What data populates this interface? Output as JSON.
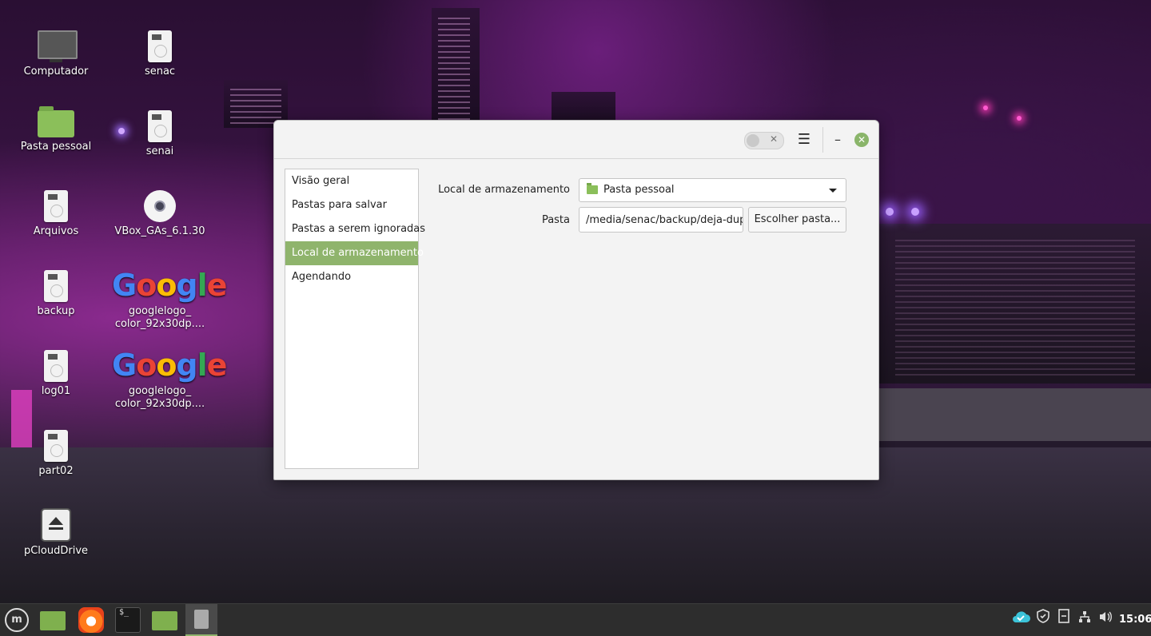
{
  "desktop": {
    "icons": [
      {
        "label": "Computador",
        "icon": "computer-icon"
      },
      {
        "label": "senac",
        "icon": "drive-icon"
      },
      {
        "label": "Pasta pessoal",
        "icon": "home-folder-icon"
      },
      {
        "label": "senai",
        "icon": "drive-icon"
      },
      {
        "label": "Arquivos",
        "icon": "drive-icon"
      },
      {
        "label": "VBox_GAs_6.1.30",
        "icon": "cd-icon"
      },
      {
        "label": "backup",
        "icon": "drive-icon"
      },
      {
        "label": "googlelogo_\ncolor_92x30dp....",
        "icon": "image-thumbnail"
      },
      {
        "label": "log01",
        "icon": "drive-icon"
      },
      {
        "label": "googlelogo_\ncolor_92x30dp....",
        "icon": "image-thumbnail"
      },
      {
        "label": "part02",
        "icon": "drive-icon"
      },
      {
        "label": "pCloudDrive",
        "icon": "eject-drive-icon"
      }
    ],
    "google_letters": [
      "G",
      "o",
      "o",
      "g",
      "l",
      "e"
    ]
  },
  "dialog": {
    "titlebar": {
      "switch_state": "off",
      "switch_symbol": "✕",
      "menu_symbol": "☰",
      "minimize_symbol": "–",
      "close_symbol": "✕",
      "close_color": "#8ab56a"
    },
    "sidebar": {
      "items": [
        {
          "label": "Visão geral",
          "active": false
        },
        {
          "label": "Pastas para salvar",
          "active": false
        },
        {
          "label": "Pastas a serem ignoradas",
          "active": false
        },
        {
          "label": "Local de armazenamento",
          "active": true
        },
        {
          "label": "Agendando",
          "active": false
        }
      ],
      "accent": "#8fb46c"
    },
    "storage": {
      "location_label": "Local de armazenamento",
      "location_value": "Pasta pessoal",
      "folder_label": "Pasta",
      "folder_value": "/media/senac/backup/deja-dup",
      "choose_button": "Escolher pasta..."
    }
  },
  "taskbar": {
    "launchers": [
      "menu-icon",
      "files-icon",
      "firefox-icon",
      "terminal-icon",
      "files-icon",
      "backup-app-icon"
    ],
    "terminal_prompt": "$_",
    "tray": [
      "pcloud-sync-icon",
      "shield-icon",
      "notes-icon",
      "network-icon",
      "volume-icon"
    ],
    "clock": "15:06"
  }
}
